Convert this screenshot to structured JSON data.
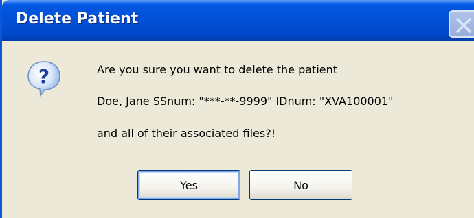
{
  "window": {
    "title": "Delete Patient",
    "close_icon": "close-icon"
  },
  "dialog": {
    "icon": "question-icon",
    "line1": "Are you sure you want to delete the patient",
    "line2": "Doe, Jane  SSnum: \"***-**-9999\"  IDnum: \"XVA100001\"",
    "line3": "and all of their associated files?!"
  },
  "buttons": {
    "yes_label": "Yes",
    "no_label": "No"
  },
  "colors": {
    "titlebar": "#0151d6",
    "dialog_background": "#ece9d8",
    "button_border": "#003c74"
  }
}
